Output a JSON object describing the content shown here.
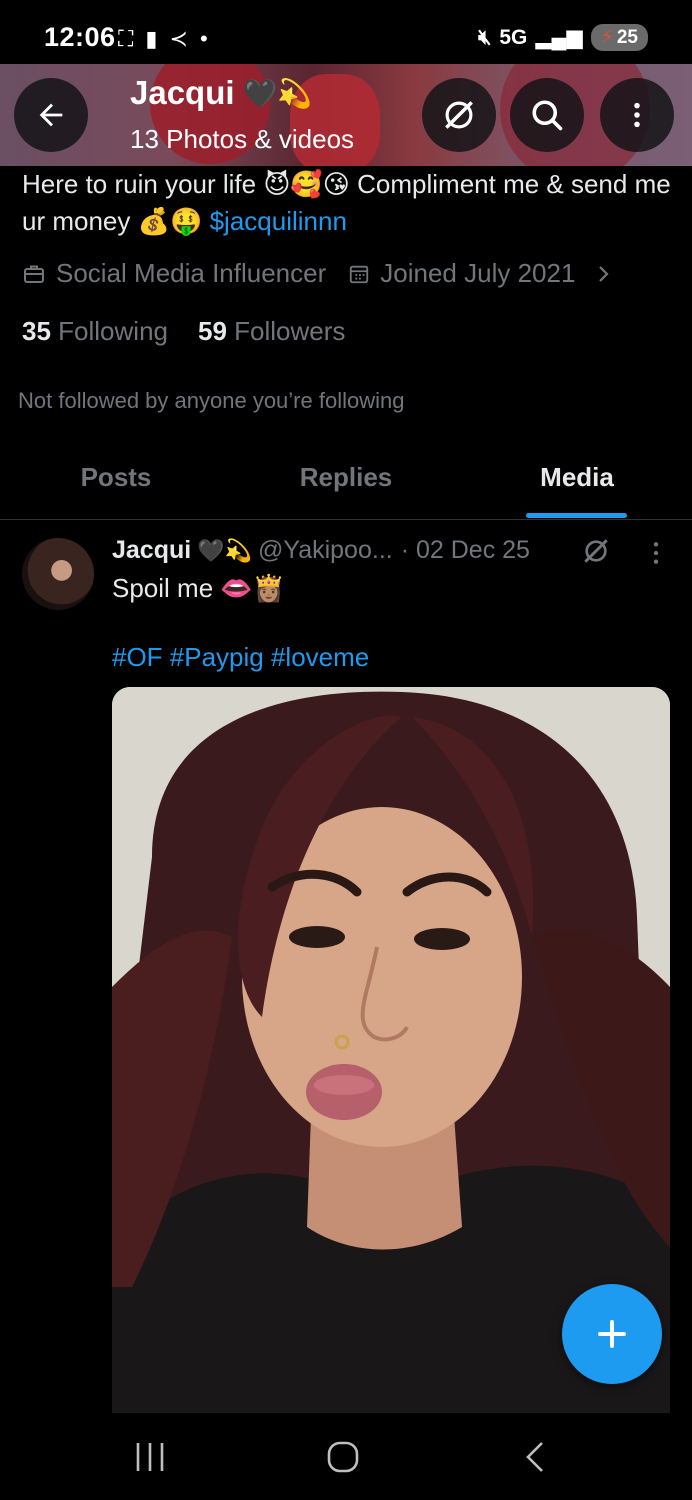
{
  "status_bar": {
    "time": "12:06",
    "network": "5G",
    "battery": "25"
  },
  "header": {
    "title": "Jacqui",
    "title_emoji": "🖤💫",
    "subtitle": "13 Photos & videos"
  },
  "profile": {
    "bio_text": "Here to ruin your life 😈🥰😘 Compliment me & send me ur money 💰🤑 ",
    "bio_link": "$jacquilinnn",
    "category": "Social Media Influencer",
    "joined": "Joined July 2021",
    "following_count": "35",
    "following_label": "Following",
    "followers_count": "59",
    "followers_label": "Followers",
    "not_followed_text": "Not followed by anyone you’re following"
  },
  "tabs": [
    {
      "label": "Posts",
      "active": false
    },
    {
      "label": "Replies",
      "active": false
    },
    {
      "label": "Media",
      "active": true
    }
  ],
  "post": {
    "author_name": "Jacqui",
    "author_emoji": "🖤💫",
    "handle": "@Yakipoo...",
    "date": "· 02 Dec 25",
    "text": "Spoil me 👄👸🏽",
    "hashtags": "#OF #Paypig #loveme"
  },
  "icons": {
    "back": "back-arrow-icon",
    "hide": "grok-icon",
    "search": "search-icon",
    "more": "more-vertical-icon",
    "category": "briefcase-icon",
    "joined": "calendar-icon",
    "fab": "plus-icon"
  },
  "colors": {
    "accent": "#1d9bf0",
    "background": "#000000",
    "muted": "#71767b"
  }
}
